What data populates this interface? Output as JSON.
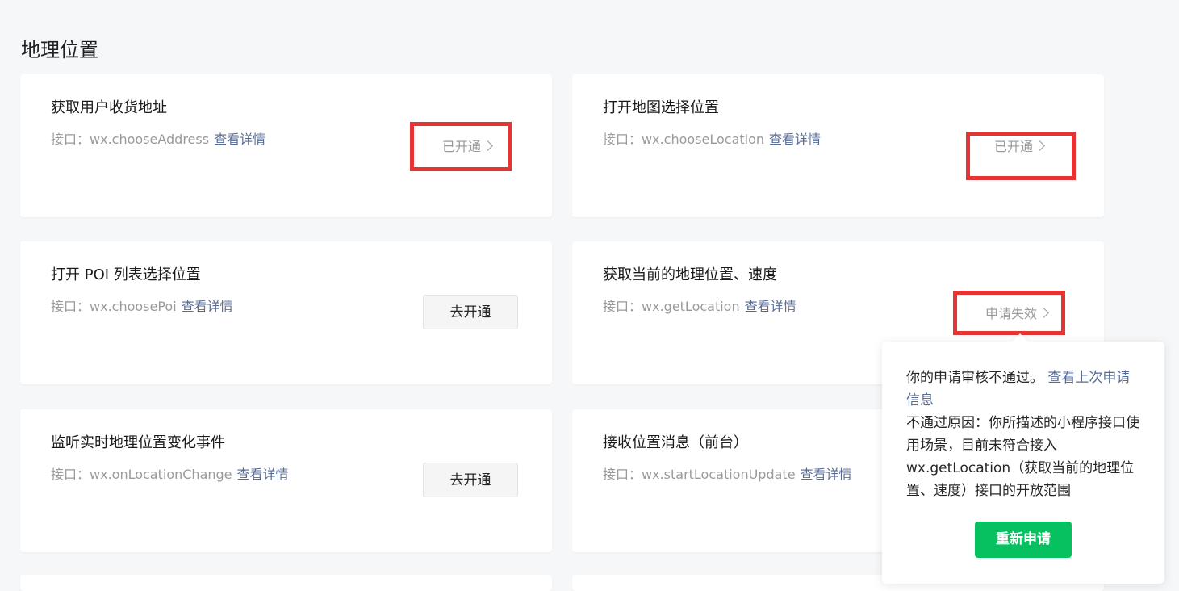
{
  "section": {
    "title": "地理位置"
  },
  "cards": [
    {
      "title": "获取用户收货地址",
      "api_prefix": "接口：",
      "api_name": "wx.chooseAddress",
      "detail_label": "查看详情",
      "status": "已开通"
    },
    {
      "title": "打开地图选择位置",
      "api_prefix": "接口：",
      "api_name": "wx.chooseLocation",
      "detail_label": "查看详情",
      "status": "已开通"
    },
    {
      "title": "打开 POI 列表选择位置",
      "api_prefix": "接口：",
      "api_name": "wx.choosePoi",
      "detail_label": "查看详情",
      "button": "去开通"
    },
    {
      "title": "获取当前的地理位置、速度",
      "api_prefix": "接口：",
      "api_name": "wx.getLocation",
      "detail_label": "查看详情",
      "status": "申请失效"
    },
    {
      "title": "监听实时地理位置变化事件",
      "api_prefix": "接口：",
      "api_name": "wx.onLocationChange",
      "detail_label": "查看详情",
      "button": "去开通"
    },
    {
      "title": "接收位置消息（前台）",
      "api_prefix": "接口：",
      "api_name": "wx.startLocationUpdate",
      "detail_label": "查看详情"
    }
  ],
  "popover": {
    "line1": "你的申请审核不通过。",
    "link": "查看上次申请信息",
    "reason": "不通过原因：你所描述的小程序接口使用场景，目前未符合接入wx.getLocation（获取当前的地理位置、速度）接口的开放范围",
    "button": "重新申请"
  },
  "colors": {
    "background": "#f6f7f9",
    "card": "#ffffff",
    "link": "#576b95",
    "muted": "#9a9a9a",
    "highlight": "#e53434",
    "primary": "#07c160"
  }
}
